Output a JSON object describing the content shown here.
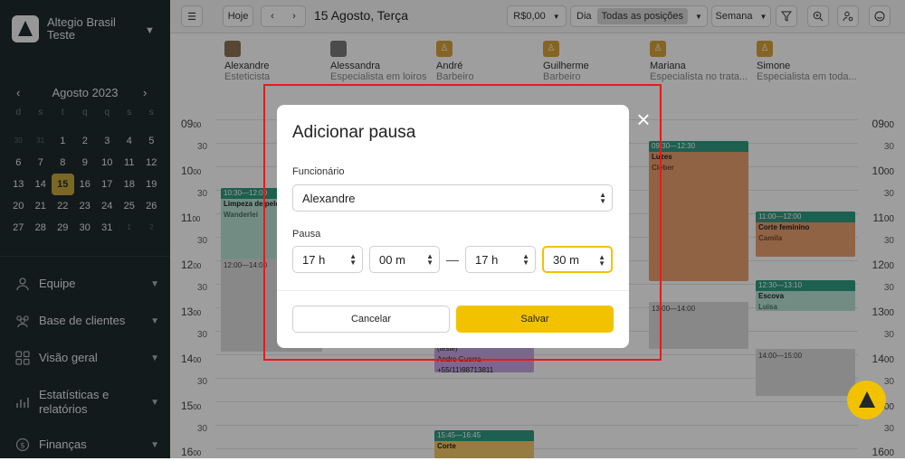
{
  "company": {
    "name": "Altegio Brasil Teste"
  },
  "mini_calendar": {
    "title": "Agosto 2023",
    "weekdays": [
      "d",
      "s",
      "t",
      "q",
      "q",
      "s",
      "s"
    ],
    "weeks": [
      [
        "30",
        "31",
        "1",
        "2",
        "3",
        "4",
        "5"
      ],
      [
        "6",
        "7",
        "8",
        "9",
        "10",
        "11",
        "12"
      ],
      [
        "13",
        "14",
        "15",
        "16",
        "17",
        "18",
        "19"
      ],
      [
        "20",
        "21",
        "22",
        "23",
        "24",
        "25",
        "26"
      ],
      [
        "27",
        "28",
        "29",
        "30",
        "31",
        "1",
        "2"
      ]
    ],
    "selected": "15"
  },
  "nav": {
    "equipe": "Equipe",
    "clientes": "Base de clientes",
    "visao": "Visão geral",
    "estatisticas": "Estatísticas e relatórios",
    "financas": "Finanças"
  },
  "topbar": {
    "today": "Hoje",
    "date": "15 Agosto, Terça",
    "amount": "R$0,00",
    "day": "Dia",
    "positions": "Todas as posições",
    "week": "Semana"
  },
  "staff": [
    {
      "name": "Alexandre",
      "role": "Esteticista"
    },
    {
      "name": "Alessandra",
      "role": "Especialista em loiros"
    },
    {
      "name": "André",
      "role": "Barbeiro"
    },
    {
      "name": "Guilherme",
      "role": "Barbeiro"
    },
    {
      "name": "Mariana",
      "role": "Especialista no trata..."
    },
    {
      "name": "Simone",
      "role": "Especialista em toda..."
    }
  ],
  "times": {
    "h09": "09",
    "h10": "10",
    "h11": "11",
    "h12": "12",
    "h13": "13",
    "h14": "14",
    "h15": "15",
    "h16": "16",
    "min00": "00",
    "min30": "30"
  },
  "events": {
    "e1_time": "10:30—12:00",
    "e1_service": "Limpeza de pele",
    "e1_client": "Wanderlei",
    "e2_time": "12:00—14:00",
    "e3_time": "09:30—12:30",
    "e3_service": "Luzes",
    "e3_client": "Cleber",
    "e4_time": "11:00—12:00",
    "e4_service": "Corte feminino",
    "e4_client": "Camila",
    "e5_time": "12:30—13:10",
    "e5_service": "Escova",
    "e5_client": "Luisa",
    "e6_time": "13:00—14:00",
    "e7_time": "14:00—15:00",
    "e8_line1": "(teste)",
    "e8_line2": "Andre Guerra",
    "e8_line3": "+55(11)98713811",
    "e9_time": "15:45—16:45",
    "e9_service": "Corte"
  },
  "modal": {
    "title": "Adicionar pausa",
    "employee_label": "Funcionário",
    "employee_value": "Alexandre",
    "pause_label": "Pausa",
    "start_hour": "17 h",
    "start_min": "00 m",
    "end_hour": "17 h",
    "end_min": "30 m",
    "dash": "—",
    "cancel": "Cancelar",
    "save": "Salvar"
  },
  "colors": {
    "sidebar": "#1f2a2c",
    "accent": "#f2c200",
    "teal": "#2f9b80",
    "orange": "#e8a070",
    "purple": "#c3a9e0",
    "highlight": "#e81a1a"
  }
}
